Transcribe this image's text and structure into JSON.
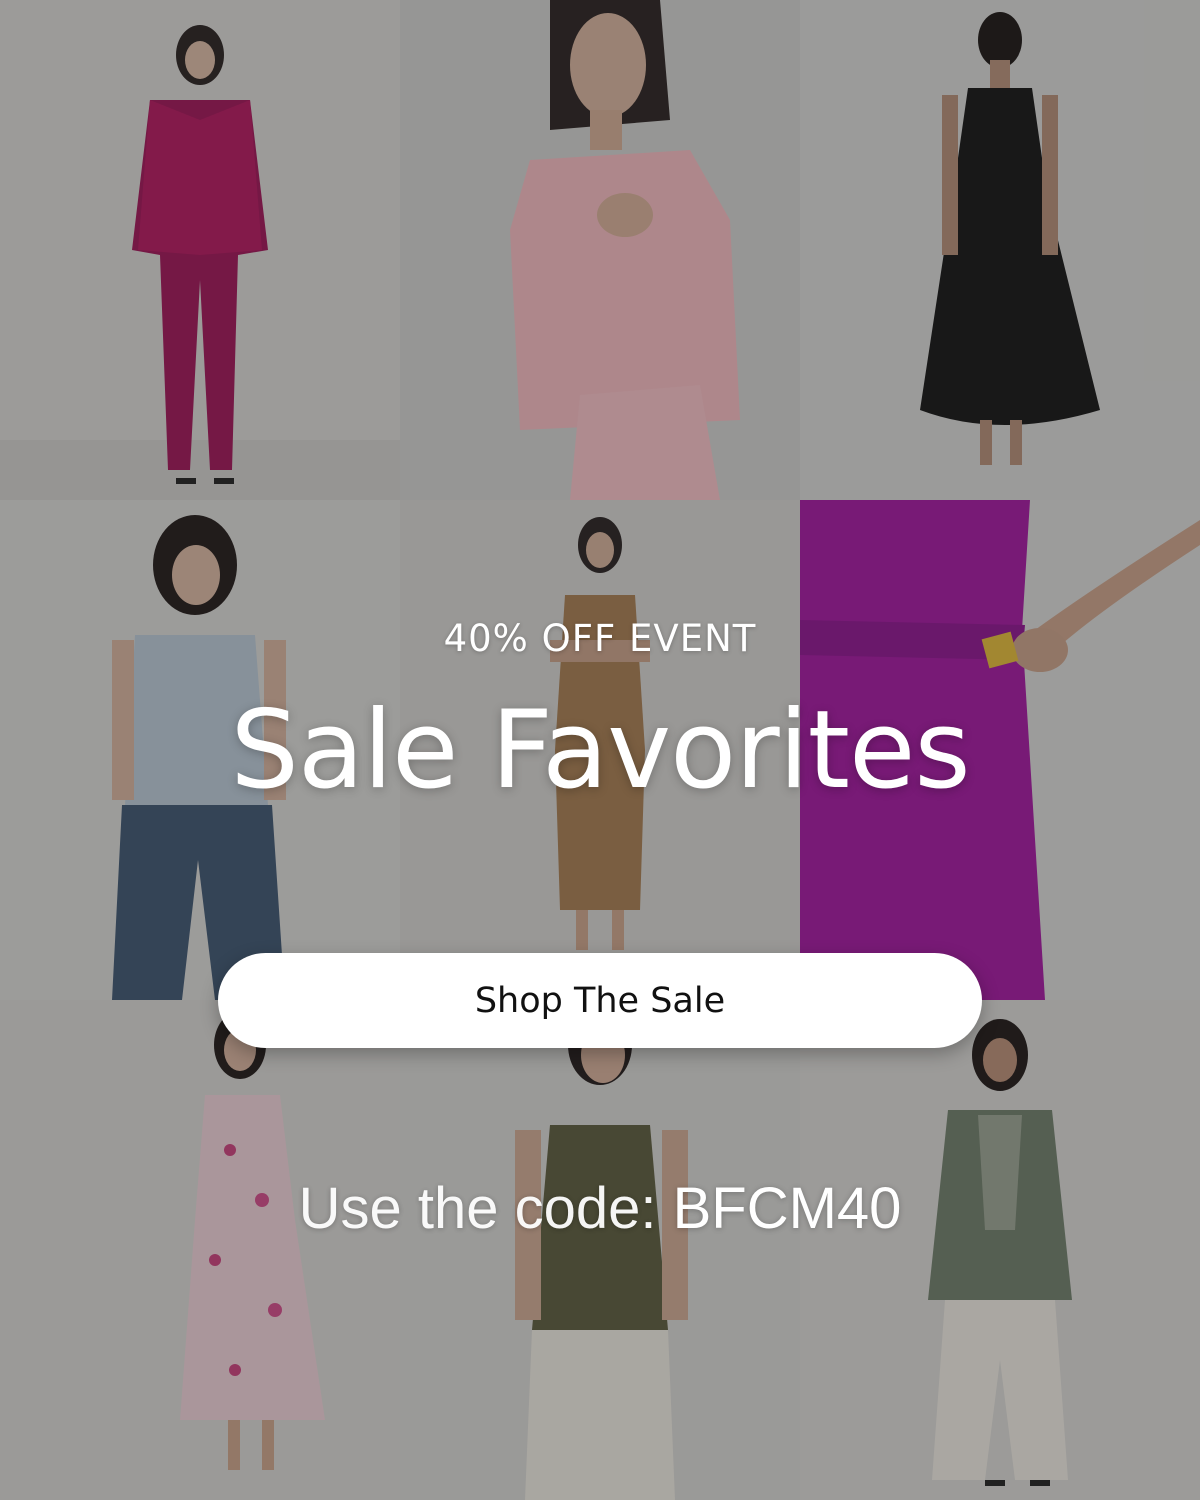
{
  "promo": {
    "eyebrow": "40% OFF EVENT",
    "title": "Sale Favorites",
    "cta_label": "Shop The Sale",
    "code_label": "Use the code:",
    "code_value": "BFCM40"
  },
  "colors": {
    "overlay": "#1e1e1e",
    "text": "#ffffff",
    "button_bg": "#ffffff",
    "button_text": "#111111"
  },
  "tiles": [
    {
      "name": "magenta-suit-look",
      "outfit": "magenta suit"
    },
    {
      "name": "pink-blouse-look",
      "outfit": "pink blouse"
    },
    {
      "name": "black-dress-look",
      "outfit": "black dress"
    },
    {
      "name": "blue-vest-jeans-look",
      "outfit": "blue vest and jeans"
    },
    {
      "name": "camel-knit-dress-look",
      "outfit": "camel knit dress"
    },
    {
      "name": "purple-pants-detail",
      "outfit": "purple pants"
    },
    {
      "name": "floral-dress-look",
      "outfit": "floral dress"
    },
    {
      "name": "olive-knit-tank-look",
      "outfit": "olive knit tank"
    },
    {
      "name": "sage-blazer-look",
      "outfit": "sage blazer and white pants"
    }
  ]
}
